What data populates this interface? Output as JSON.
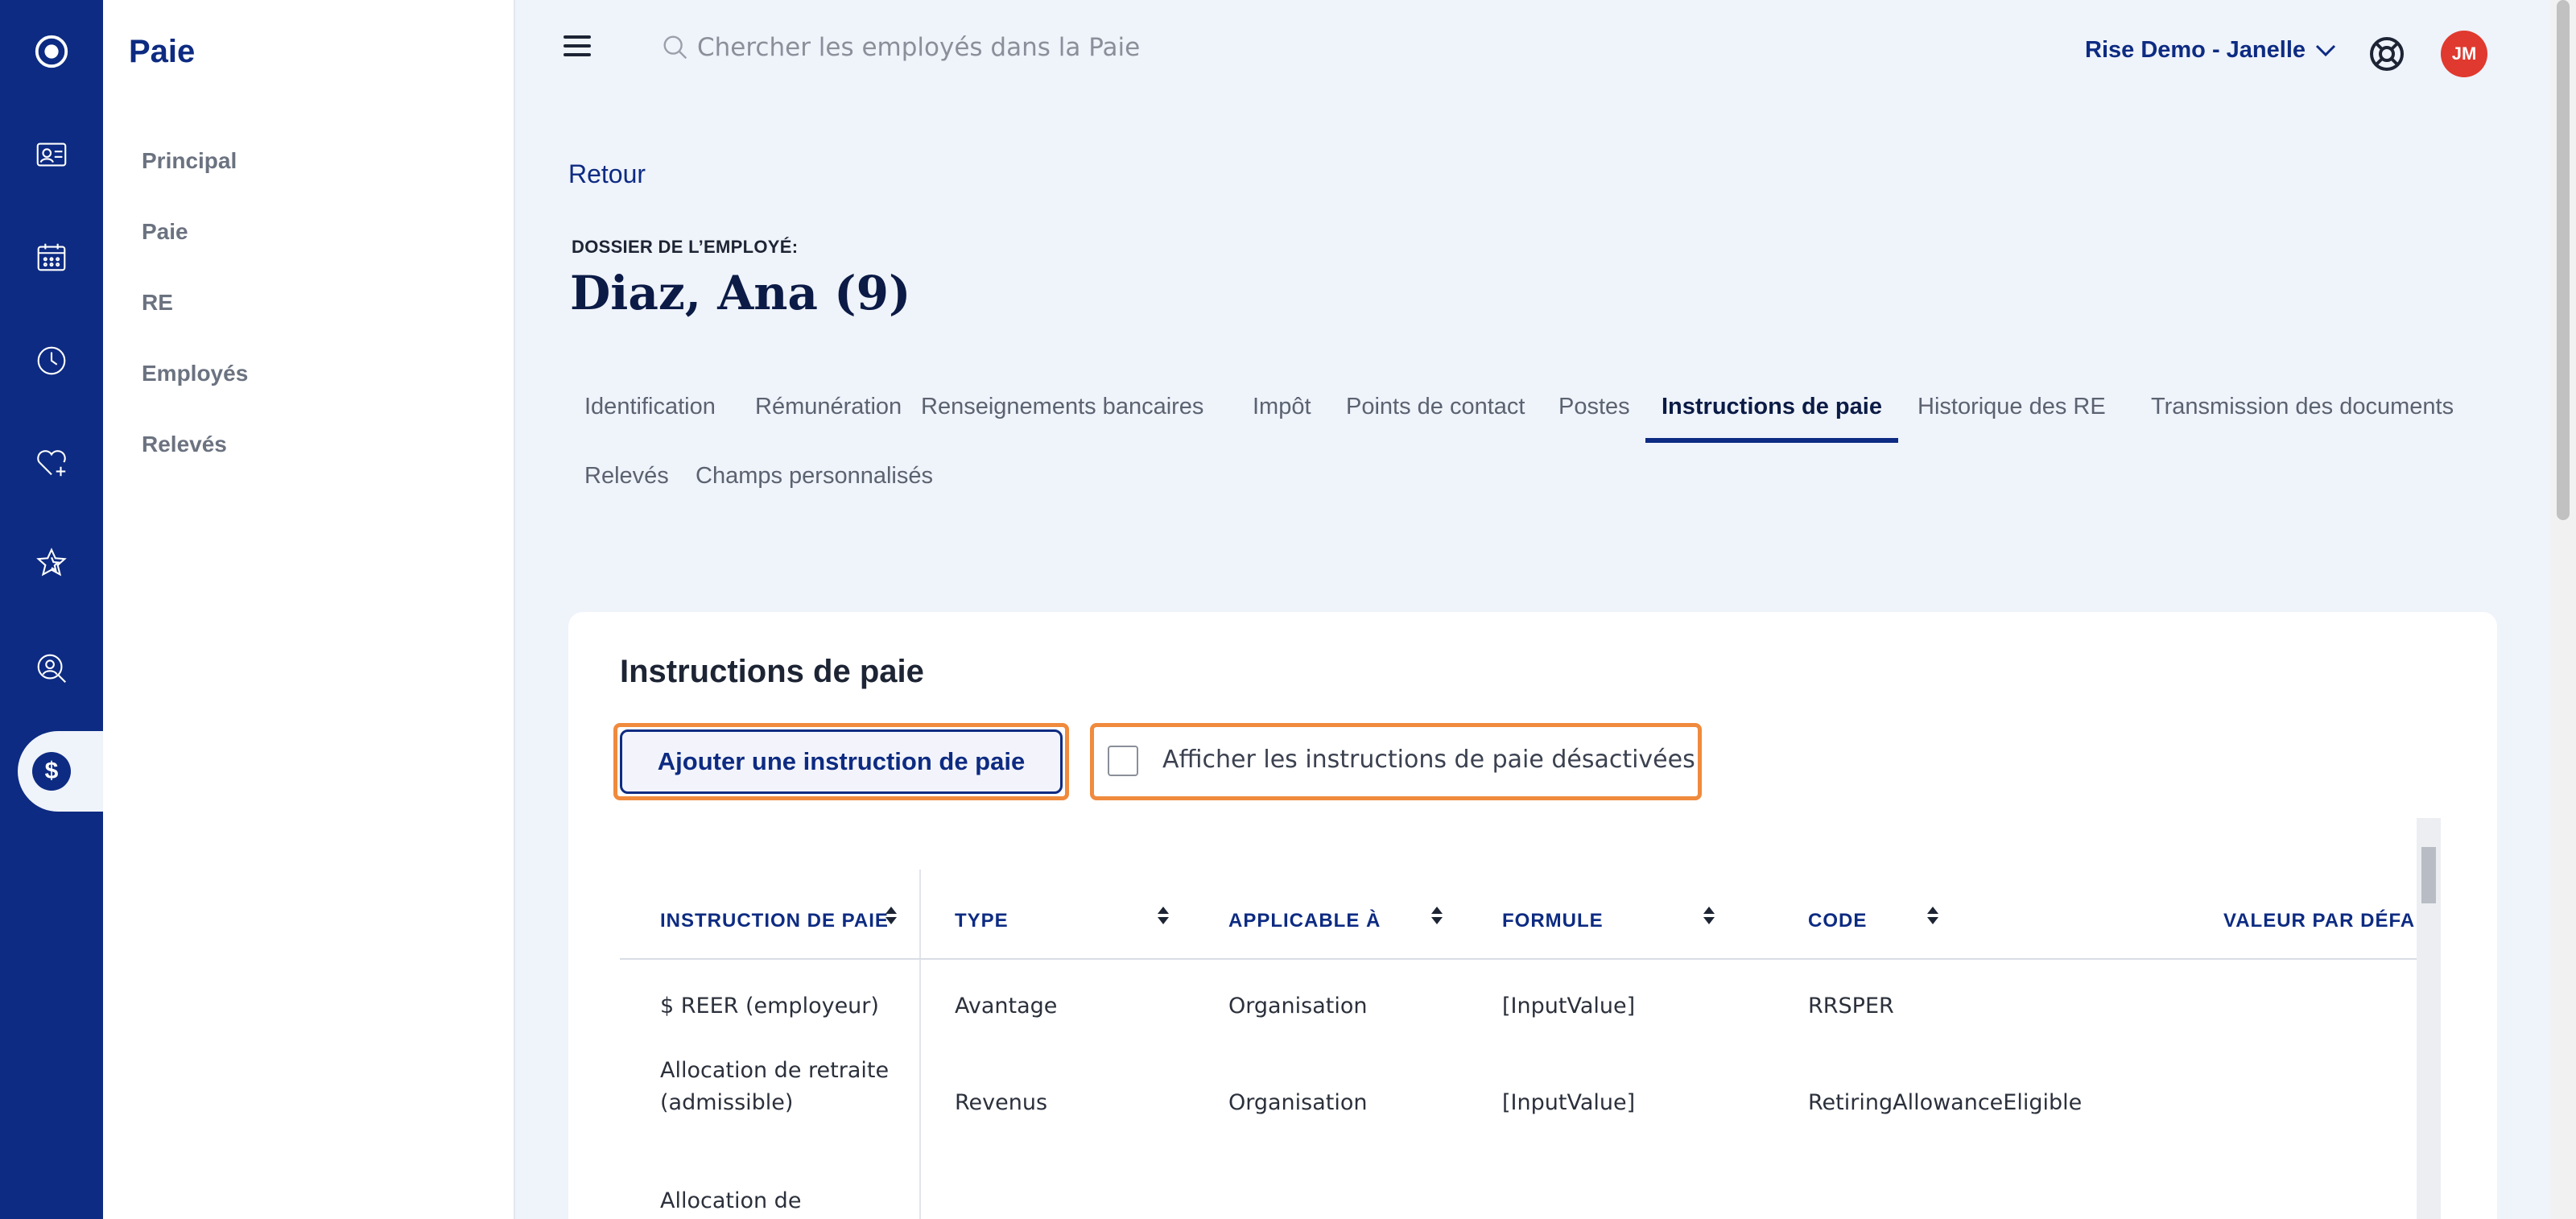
{
  "rail": {
    "icons": [
      "logo-icon",
      "employee-card-icon",
      "calendar-icon",
      "clock-icon",
      "heart-plus-icon",
      "star-icon",
      "search-person-icon",
      "dollar-icon"
    ]
  },
  "sidebar": {
    "title": "Paie",
    "items": [
      {
        "label": "Principal"
      },
      {
        "label": "Paie"
      },
      {
        "label": "RE"
      },
      {
        "label": "Employés"
      },
      {
        "label": "Relevés"
      }
    ]
  },
  "topbar": {
    "search_placeholder": "Chercher les employés dans la Paie",
    "account_label": "Rise Demo - Janelle",
    "avatar_initials": "JM"
  },
  "header": {
    "back_label": "Retour",
    "dossier_label": "DOSSIER DE L’EMPLOYÉ:",
    "employee_name": "Diaz, Ana (9)"
  },
  "tabs": [
    {
      "label": "Identification",
      "active": false
    },
    {
      "label": "Rémunération",
      "active": false
    },
    {
      "label": "Renseignements bancaires",
      "active": false
    },
    {
      "label": "Impôt",
      "active": false
    },
    {
      "label": "Points de contact",
      "active": false
    },
    {
      "label": "Postes",
      "active": false
    },
    {
      "label": "Instructions de paie",
      "active": true
    },
    {
      "label": "Historique des RE",
      "active": false
    },
    {
      "label": "Transmission des documents",
      "active": false
    },
    {
      "label": "Relevés",
      "active": false
    },
    {
      "label": "Champs personnalisés",
      "active": false
    }
  ],
  "card": {
    "title": "Instructions de paie",
    "add_button_label": "Ajouter une instruction de paie",
    "show_disabled_label": "Afficher les instructions de paie désactivées",
    "show_disabled_checked": false
  },
  "table": {
    "columns": [
      "INSTRUCTION DE PAIE",
      "TYPE",
      "APPLICABLE À",
      "FORMULE",
      "CODE",
      "VALEUR PAR DÉFA"
    ],
    "rows": [
      {
        "instruction": "$ REER (employeur)",
        "type": "Avantage",
        "applicable": "Organisation",
        "formule": "[InputValue]",
        "code": "RRSPER"
      },
      {
        "instruction": "Allocation de retraite (admissible)",
        "type": "Revenus",
        "applicable": "Organisation",
        "formule": "[InputValue]",
        "code": "RetiringAllowanceEligible"
      },
      {
        "instruction": "Allocation de",
        "type": "",
        "applicable": "",
        "formule": "",
        "code": ""
      }
    ]
  },
  "colors": {
    "brand_navy": "#0d2b82",
    "highlight_orange": "#f08a3d",
    "avatar_red": "#e0392f",
    "page_bg": "#eff3fa"
  }
}
